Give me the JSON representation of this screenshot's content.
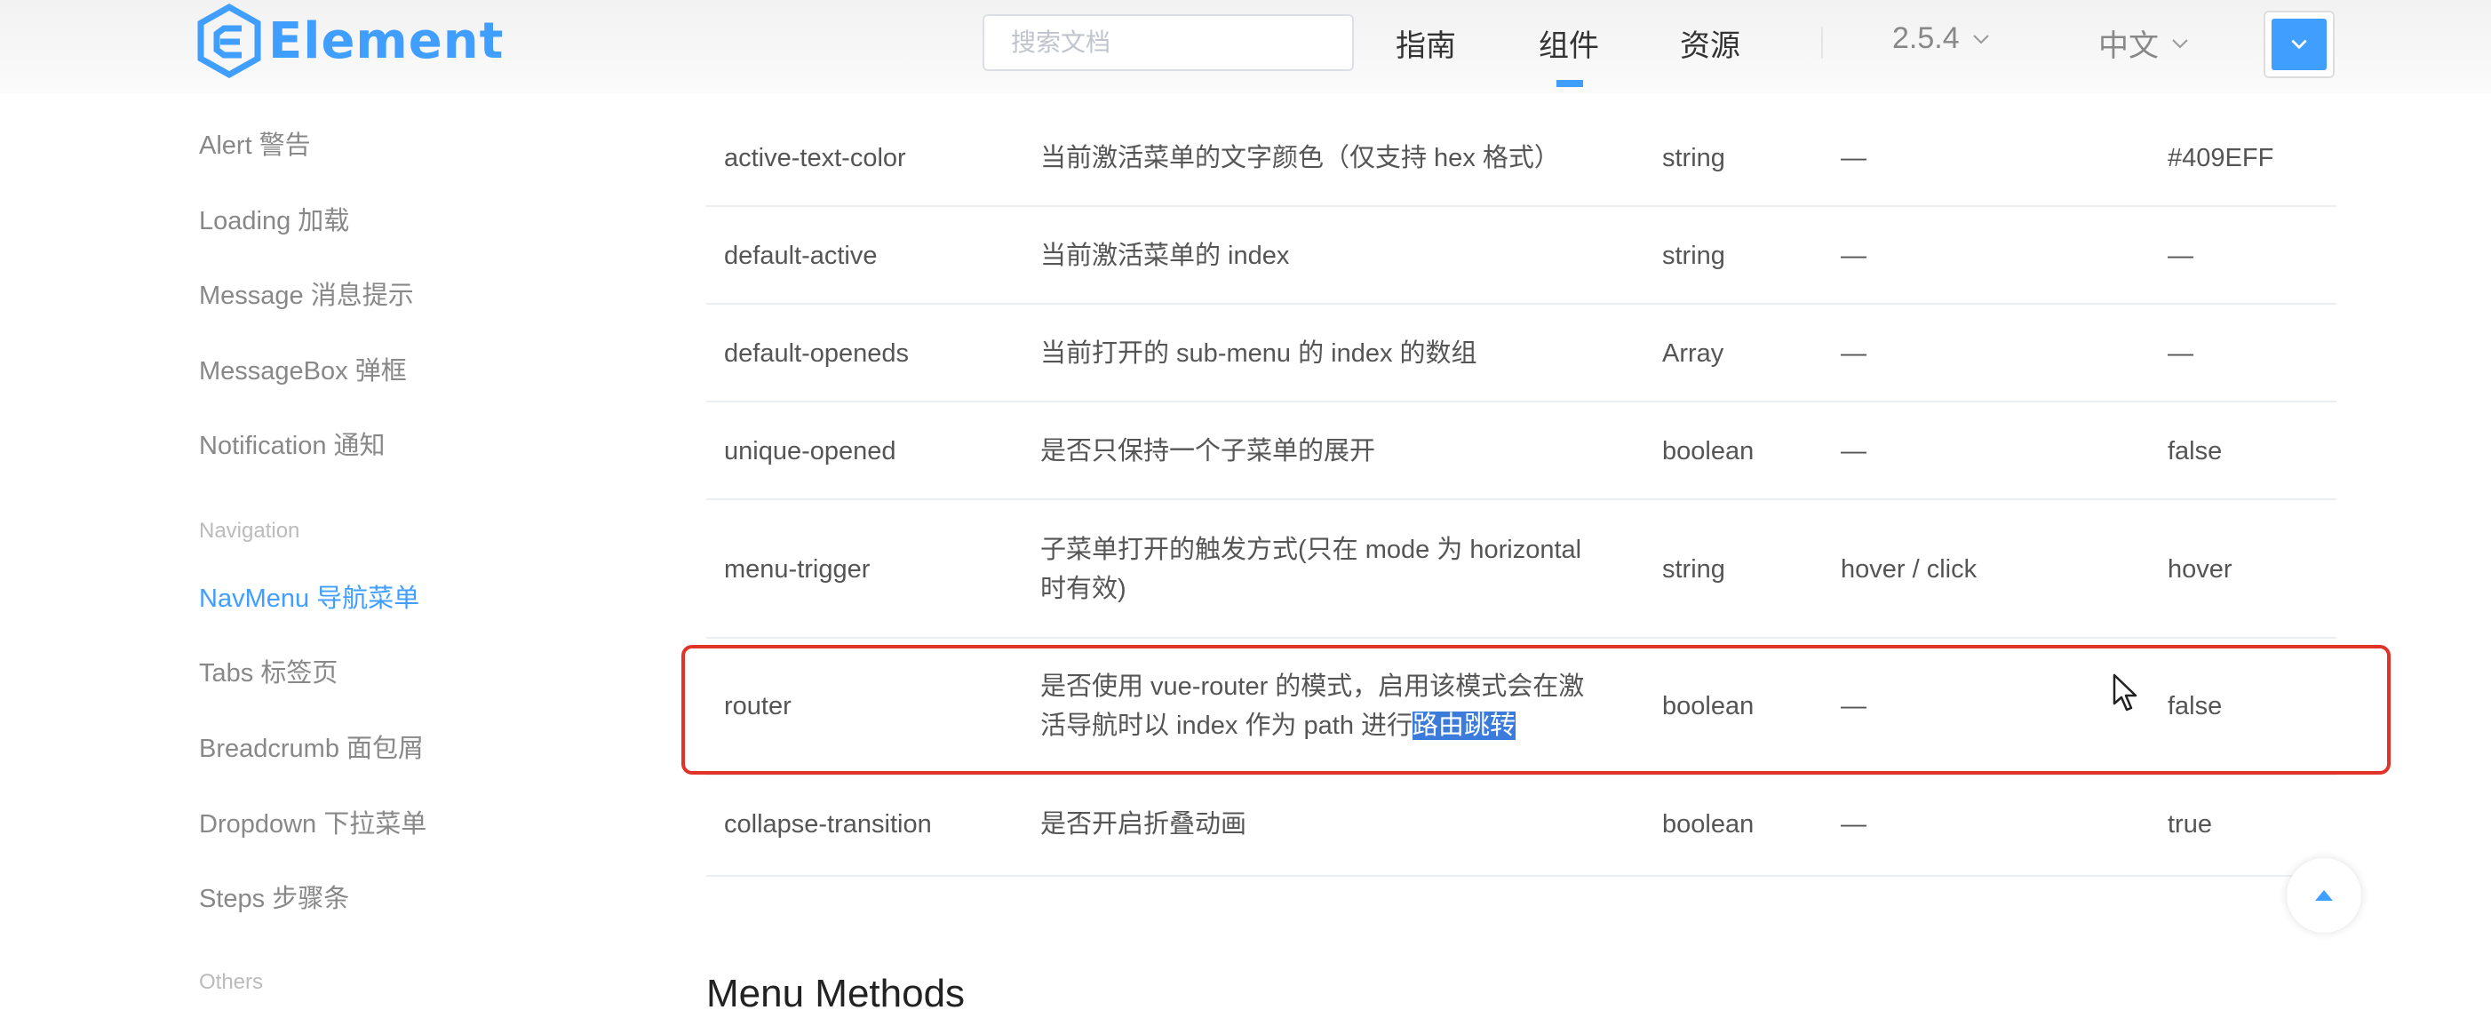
{
  "header": {
    "logo_text": "Element",
    "search_placeholder": "搜索文档",
    "nav": {
      "guide": "指南",
      "component": "组件",
      "resource": "资源"
    },
    "version": "2.5.4",
    "language": "中文",
    "accent_color": "#409EFF"
  },
  "sidebar": {
    "items_top": [
      "Alert 警告",
      "Loading 加载",
      "Message 消息提示",
      "MessageBox 弹框",
      "Notification 通知"
    ],
    "group_navigation": "Navigation",
    "items_nav": [
      "NavMenu 导航菜单",
      "Tabs 标签页",
      "Breadcrumb 面包屑",
      "Dropdown 下拉菜单",
      "Steps 步骤条"
    ],
    "group_others": "Others"
  },
  "table": {
    "rows": [
      {
        "param": "active-text-color",
        "desc": "当前激活菜单的文字颜色（仅支持 hex 格式）",
        "type": "string",
        "options": "—",
        "default": "#409EFF"
      },
      {
        "param": "default-active",
        "desc": "当前激活菜单的 index",
        "type": "string",
        "options": "—",
        "default": "—"
      },
      {
        "param": "default-openeds",
        "desc": "当前打开的 sub-menu 的 index 的数组",
        "type": "Array",
        "options": "—",
        "default": "—"
      },
      {
        "param": "unique-opened",
        "desc": "是否只保持一个子菜单的展开",
        "type": "boolean",
        "options": "—",
        "default": "false"
      },
      {
        "param": "menu-trigger",
        "desc_line1": "子菜单打开的触发方式(只在 mode 为 horizontal",
        "desc_line2": "时有效)",
        "type": "string",
        "options": "hover / click",
        "default": "hover"
      },
      {
        "param": "router",
        "desc_line1": "是否使用 vue-router 的模式，启用该模式会在激",
        "desc_line2": "活导航时以 index 作为 path 进行",
        "desc_selected": "路由跳转",
        "type": "boolean",
        "options": "—",
        "default": "false"
      },
      {
        "param": "collapse-transition",
        "desc": "是否开启折叠动画",
        "type": "boolean",
        "options": "—",
        "default": "true"
      }
    ]
  },
  "section_title": "Menu Methods",
  "icons": {
    "logo": "element-logo-icon",
    "chevron": "chevron-down-icon",
    "cursor": "mouse-cursor-icon",
    "back_to_top": "caret-up-icon"
  },
  "highlight_color": "#E0342A"
}
